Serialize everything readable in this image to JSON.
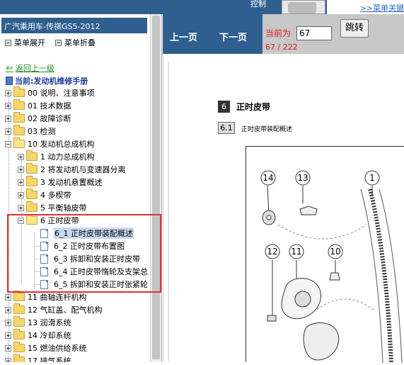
{
  "banner": {
    "ctrl_text": "控制",
    "menu_link": ">>菜单关键"
  },
  "sidebar": {
    "title": "广汽乘用车-传祺GS5-2012",
    "expand_label": "菜单展开",
    "collapse_label": "菜单折叠",
    "back_label": "返回上一级",
    "current_label": "当前:发动机维修手册",
    "tree": [
      {
        "label": "00 说明、注意事项"
      },
      {
        "label": "01 技术数据"
      },
      {
        "label": "02 故障诊断"
      },
      {
        "label": "03 检测"
      },
      {
        "label": "10 发动机总成机构"
      },
      {
        "label": "1 动力总成机构"
      },
      {
        "label": "2 将发动机与变速器分离"
      },
      {
        "label": "3 发动机悬置概述"
      },
      {
        "label": "4 多楔带"
      },
      {
        "label": "5 平衡轴皮带"
      },
      {
        "label": "6 正时皮带"
      },
      {
        "label": "6_1 正时皮带装配概述"
      },
      {
        "label": "6_2 正时皮带布置图"
      },
      {
        "label": "6_3 拆卸和安装正时皮带"
      },
      {
        "label": "6_4 正时皮带惰轮及支架总"
      },
      {
        "label": "6_5 拆卸和安装正时张紧轮"
      },
      {
        "label": "11 曲轴连杆机构"
      },
      {
        "label": "12 气缸盖、配气机构"
      },
      {
        "label": "13 润滑系统"
      },
      {
        "label": "14 冷却系统"
      },
      {
        "label": "15 燃油供给系统"
      },
      {
        "label": "17 排气系统"
      }
    ]
  },
  "toolbar": {
    "prev_label": "上一页",
    "next_label": "下一页",
    "current_label": "当前为",
    "page_value": "67",
    "goto_label": "跳转",
    "page_count": "67 / 222"
  },
  "document": {
    "section_num": "6",
    "section_title": "正时皮带",
    "sub_num": "6.1",
    "sub_title": "正时皮带装配概述",
    "callouts": [
      "14",
      "13",
      "1",
      "12",
      "11",
      "10"
    ]
  },
  "colors": {
    "header_blue": "#2e5f8f",
    "highlight_red": "#e03030",
    "page_red": "#e01a1a",
    "back_green": "#2a8a2a"
  }
}
